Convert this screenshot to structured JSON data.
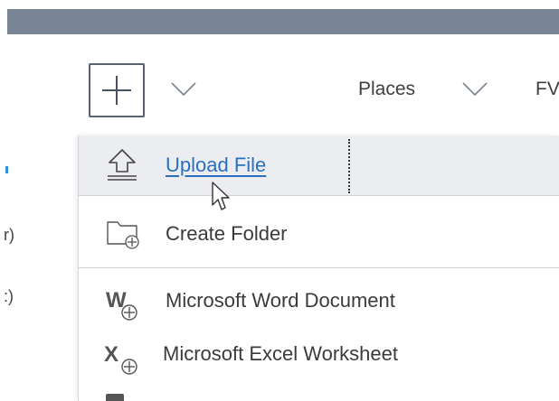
{
  "toolbar": {
    "new_button_icon": "plus-icon",
    "places_label": "Places",
    "fv_label": "FV"
  },
  "left_fragments": [
    "r)",
    ":)"
  ],
  "menu": {
    "items": [
      {
        "label": "Upload File",
        "icon": "upload-icon"
      },
      {
        "label": "Create Folder",
        "icon": "folder-plus-icon"
      },
      {
        "label": "Microsoft Word Document",
        "icon": "word-plus-icon"
      },
      {
        "label": "Microsoft Excel Worksheet",
        "icon": "excel-plus-icon"
      }
    ]
  },
  "colors": {
    "top_strip": "#7a8596",
    "link": "#2b6fc0",
    "highlight": "#ebedf0"
  }
}
